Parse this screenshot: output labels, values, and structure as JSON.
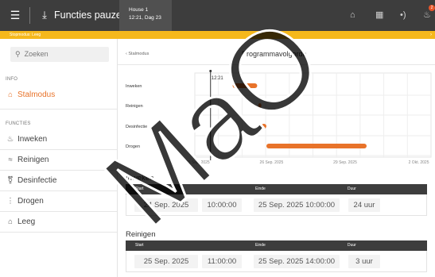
{
  "topbar": {
    "title": "Functies pauzeren",
    "house": "House 1",
    "datetime": "12:21, Dag 23",
    "alert_count": "2"
  },
  "banner": {
    "text": "Stopmodus: Leeg"
  },
  "sidebar": {
    "search_placeholder": "Zoeken",
    "info_label": "INFO",
    "info_item": "Stalmodus",
    "functies_label": "FUNCTIES",
    "items": [
      {
        "label": "Inweken",
        "icon": "droplet-icon"
      },
      {
        "label": "Reinigen",
        "icon": "spray-icon"
      },
      {
        "label": "Desinfectie",
        "icon": "flask-icon"
      },
      {
        "label": "Drogen",
        "icon": "heat-icon"
      },
      {
        "label": "Leeg",
        "icon": "house-icon"
      }
    ]
  },
  "main": {
    "back_label": "Stalmodus",
    "title": "Programmavolgorde"
  },
  "chart_data": {
    "type": "gantt",
    "rows": [
      "Inweken",
      "Reinigen",
      "Desinfectie",
      "Drogen"
    ],
    "x_ticks": [
      "23 Sep. 2025",
      "26 Sep. 2025",
      "29 Sep. 2025",
      "2 Okt. 2025"
    ],
    "now_label": "12:21",
    "now": "2025-09-23 12:21",
    "x_range": [
      "2025-09-22 21:00",
      "2025-10-02 12:00"
    ],
    "bars": [
      {
        "row": "Inweken",
        "start": "2025-09-24 10:00",
        "end": "2025-09-25 10:00"
      },
      {
        "row": "Reinigen",
        "start": "2025-09-25 11:00",
        "end": "2025-09-25 14:00"
      },
      {
        "row": "Desinfectie",
        "start": "2025-09-25 14:00",
        "end": "2025-09-25 19:00"
      },
      {
        "row": "Drogen",
        "start": "2025-09-25 19:00",
        "end": "2025-09-29 21:00"
      }
    ],
    "color": "#e8732a"
  },
  "sections": [
    {
      "title": "Inweken",
      "headers": [
        "Start",
        "Einde",
        "Duur"
      ],
      "start_date": "24 Sep. 2025",
      "start_time": "10:00:00",
      "end": "25 Sep. 2025 10:00:00",
      "duration": "24 uur"
    },
    {
      "title": "Reinigen",
      "headers": [
        "Start",
        "Einde",
        "Duur"
      ],
      "start_date": "25 Sep. 2025",
      "start_time": "11:00:00",
      "end": "25 Sep. 2025 14:00:00",
      "duration": "3 uur"
    }
  ],
  "watermark": {
    "text": "MaO"
  },
  "colors": {
    "accent": "#e8732a",
    "banner": "#f5b81c",
    "topbar": "#3d3d3d"
  }
}
